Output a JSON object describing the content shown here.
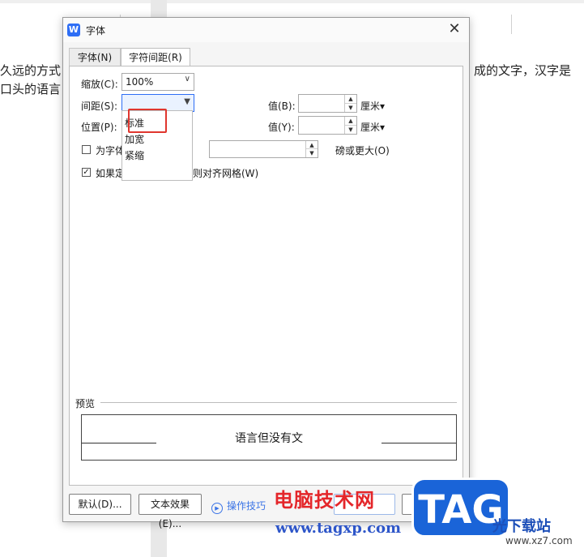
{
  "document": {
    "line1_left": "久远的方式",
    "line2_left": "口头的语言",
    "line1_right": "成的文字，汉字是"
  },
  "dialog": {
    "title": "字体",
    "app_icon_letter": "W",
    "close_glyph": "✕",
    "tabs": [
      {
        "label": "字体(N)"
      },
      {
        "label": "字符间距(R)"
      }
    ],
    "scale": {
      "label": "缩放(C):",
      "value": "100%"
    },
    "spacing": {
      "label": "间距(S):",
      "value": "",
      "value_label": "值(B):",
      "unit": "厘米▾"
    },
    "position": {
      "label": "位置(P):",
      "value_label": "值(Y):",
      "unit": "厘米▾"
    },
    "kerning": {
      "label": "为字体",
      "unit": "磅或更大(O)",
      "checked": false
    },
    "grid_snap": {
      "label": "如果定义了文档网格，则对齐网格(W)",
      "checked": true
    },
    "spacing_options": [
      "标准",
      "加宽",
      "紧缩"
    ],
    "preview": {
      "label": "预览",
      "sample": "语言但没有文"
    },
    "buttons": {
      "default": "默认(D)...",
      "text_effects": "文本效果(E)...",
      "tips": "操作技巧"
    }
  },
  "watermark": {
    "brand": "电脑技术网",
    "url": "www.tagxp.com",
    "logo": "TAG",
    "site": "光下载站",
    "site_url": "www.xz7.com"
  },
  "colors": {
    "accent": "#2e6ef5",
    "highlight_border": "#e0362e",
    "link": "#3b74e6"
  }
}
